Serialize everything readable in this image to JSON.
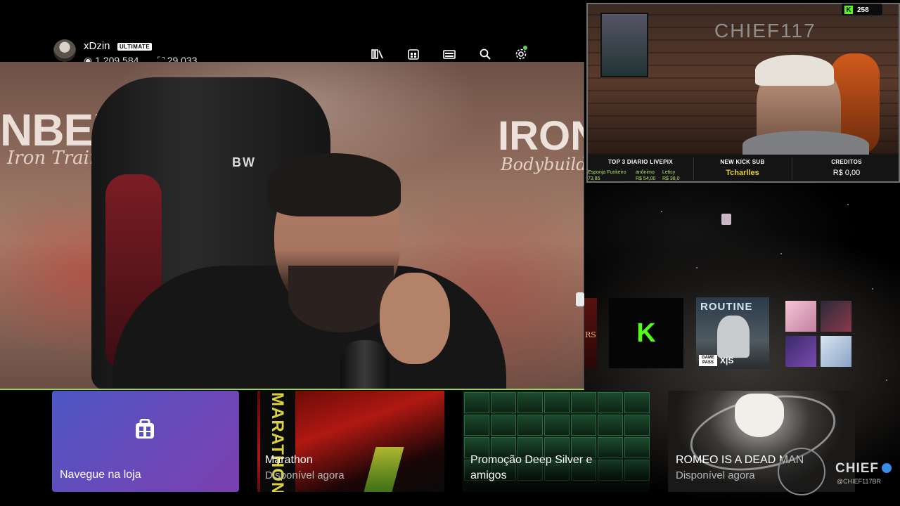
{
  "profile": {
    "gamertag": "xDzin",
    "badge": "ULTIMATE",
    "gamerscore": "1.209.584",
    "rewards": "29.033"
  },
  "top_icons": [
    "library-icon",
    "store-icon",
    "game-pass-icon",
    "search-icon",
    "settings-icon"
  ],
  "main_video": {
    "sign_left": "NBERG",
    "sign_left_sub": "Iron Training Center",
    "sign_right": "IRON",
    "sign_right_sub": "Bodybuilding",
    "chair_logo": "BW"
  },
  "webcam": {
    "wall_logo": "CHIEF117",
    "kick_viewers": "258",
    "bar": {
      "top3_title": "TOP 3 DIARIO LIVEPIX",
      "donors": [
        {
          "name": "Esponja Funkeiro",
          "amount": "73,85"
        },
        {
          "name": "anônimo",
          "amount": "R$ 54,00"
        },
        {
          "name": "Leticy",
          "amount": "R$ 38,0"
        }
      ],
      "sub_title": "NEW KICK SUB",
      "sub_name": "Tcharlles",
      "credits_title": "CREDITOS",
      "credits_value": "R$ 0,00"
    }
  },
  "small_tiles": {
    "routine_title": "ROUTINE",
    "gamepass_label": "GAME PASS",
    "xs_label": "X|S",
    "kick_logo": "K",
    "partial_text": "RS"
  },
  "bottom_tiles": [
    {
      "label": "Navegue na loja",
      "sub": ""
    },
    {
      "label": "Marathon",
      "sub": "Disponível agora",
      "strip": "MARATHON"
    },
    {
      "label": "Promoção Deep Silver e amigos",
      "sub": ""
    },
    {
      "label": "ROMEO IS A DEAD MAN",
      "sub": "Disponível agora"
    }
  ],
  "watermark": {
    "name": "CHIEF",
    "handle": "@CHIEF117BR"
  },
  "colors": {
    "kick_green": "#53fc18",
    "store_tile": "#5b50c0",
    "video_border": "#9ed25a",
    "sub_name": "#e6cf3a"
  }
}
